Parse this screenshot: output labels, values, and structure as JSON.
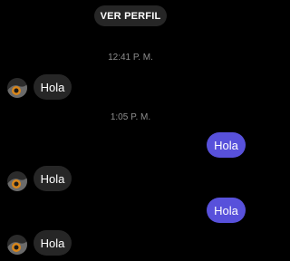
{
  "header": {
    "profile_button_label": "VER PERFIL"
  },
  "messages": [
    {
      "kind": "timestamp",
      "text": "12:41 P. M."
    },
    {
      "kind": "incoming",
      "text": "Hola"
    },
    {
      "kind": "timestamp",
      "text": "1:05 P. M."
    },
    {
      "kind": "outgoing",
      "text": "Hola"
    },
    {
      "kind": "incoming",
      "text": "Hola"
    },
    {
      "kind": "outgoing",
      "text": "Hola"
    },
    {
      "kind": "incoming",
      "text": "Hola"
    }
  ],
  "colors": {
    "background": "#000000",
    "incoming_bubble": "#262626",
    "outgoing_bubble": "#5851db",
    "timestamp_text": "#8e8e8e",
    "text": "#ffffff"
  },
  "icons": {
    "avatar": "contact-avatar-icon"
  }
}
